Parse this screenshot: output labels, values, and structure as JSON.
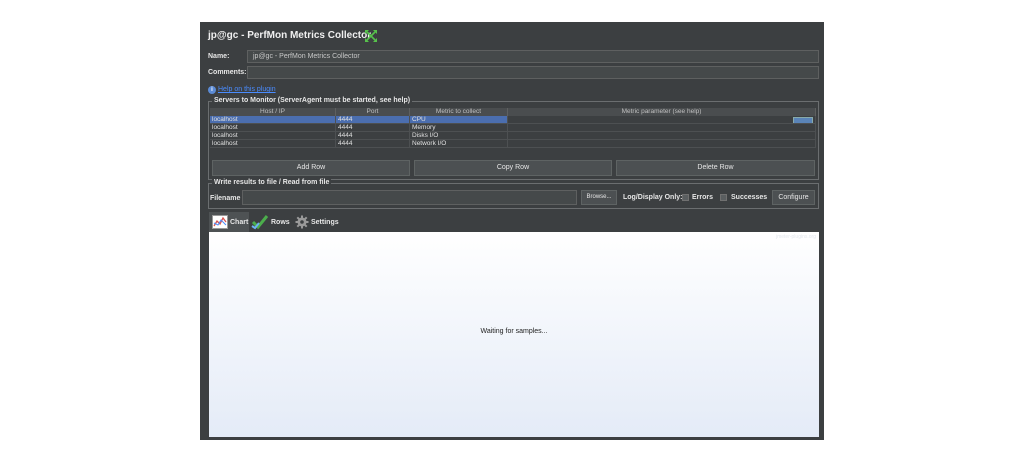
{
  "window": {
    "title": "jp@gc - PerfMon Metrics Collector"
  },
  "form": {
    "name_label": "Name:",
    "name_value": "jp@gc - PerfMon Metrics Collector",
    "comments_label": "Comments:",
    "comments_value": "",
    "help_link": "Help on this plugin"
  },
  "servers": {
    "group_title": "Servers to Monitor (ServerAgent must be started, see help)",
    "columns": [
      "Host / IP",
      "Port",
      "Metric to collect",
      "Metric parameter (see help)"
    ],
    "rows": [
      {
        "host": "localhost",
        "port": "4444",
        "metric": "CPU",
        "param": "",
        "selected": true
      },
      {
        "host": "localhost",
        "port": "4444",
        "metric": "Memory",
        "param": ""
      },
      {
        "host": "localhost",
        "port": "4444",
        "metric": "Disks I/O",
        "param": ""
      },
      {
        "host": "localhost",
        "port": "4444",
        "metric": "Network I/O",
        "param": ""
      }
    ],
    "add_row": "Add Row",
    "copy_row": "Copy Row",
    "delete_row": "Delete Row"
  },
  "file": {
    "group_title": "Write results to file / Read from file",
    "filename_label": "Filename",
    "filename_value": "",
    "browse": "Browse...",
    "log_display_label": "Log/Display Only:",
    "errors_label": "Errors",
    "successes_label": "Successes",
    "configure": "Configure"
  },
  "tabs": [
    {
      "label": "Chart",
      "icon": "chart-icon",
      "active": true
    },
    {
      "label": "Rows",
      "icon": "checkmark-icon"
    },
    {
      "label": "Settings",
      "icon": "gear-icon"
    }
  ],
  "chart": {
    "status_text": "Waiting for samples...",
    "watermark": "jmeter-plugins.org"
  },
  "colors": {
    "panel_bg": "#3c3f41",
    "selection": "#4b6eaf",
    "link": "#4a8cff"
  }
}
